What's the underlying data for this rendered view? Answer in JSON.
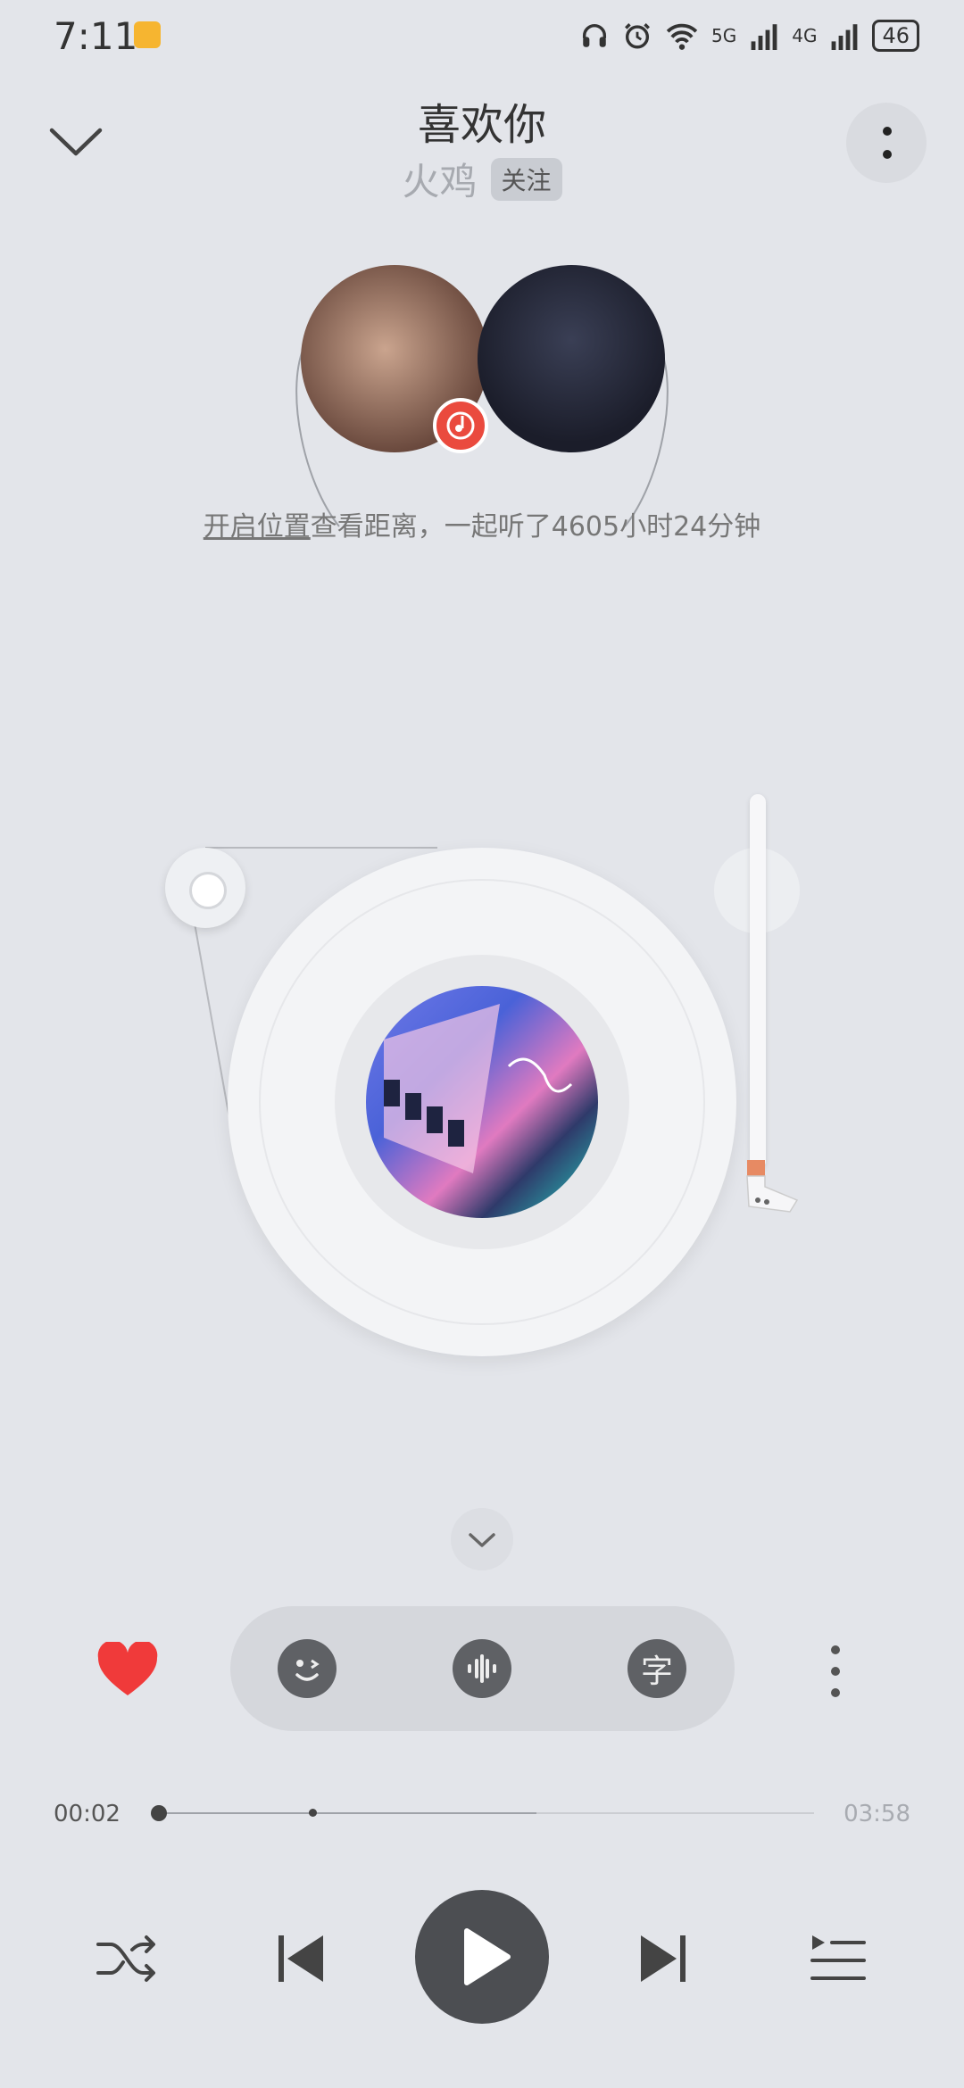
{
  "status_bar": {
    "time": "7:11",
    "network_5g": "5G",
    "network_4g": "4G",
    "battery": "46",
    "icons": [
      "headphones-icon",
      "alarm-icon",
      "wifi-icon",
      "signal-icon",
      "battery-icon"
    ]
  },
  "header": {
    "title": "喜欢你",
    "artist": "火鸡",
    "follow_label": "关注"
  },
  "together": {
    "link_text": "开启位置",
    "rest_text": "查看距离，一起听了4605小时24分钟"
  },
  "actions": {
    "liked": true,
    "like_color": "#f03a3a",
    "lyric_label": "字"
  },
  "progress": {
    "current": "00:02",
    "total": "03:58",
    "played_fraction": 0.008,
    "buffered_fraction": 0.58,
    "marker_fraction": 0.24
  },
  "controls": {
    "shuffle": "shuffle-icon",
    "previous": "previous-icon",
    "play": "play-icon",
    "next": "next-icon",
    "playlist": "playlist-icon"
  }
}
